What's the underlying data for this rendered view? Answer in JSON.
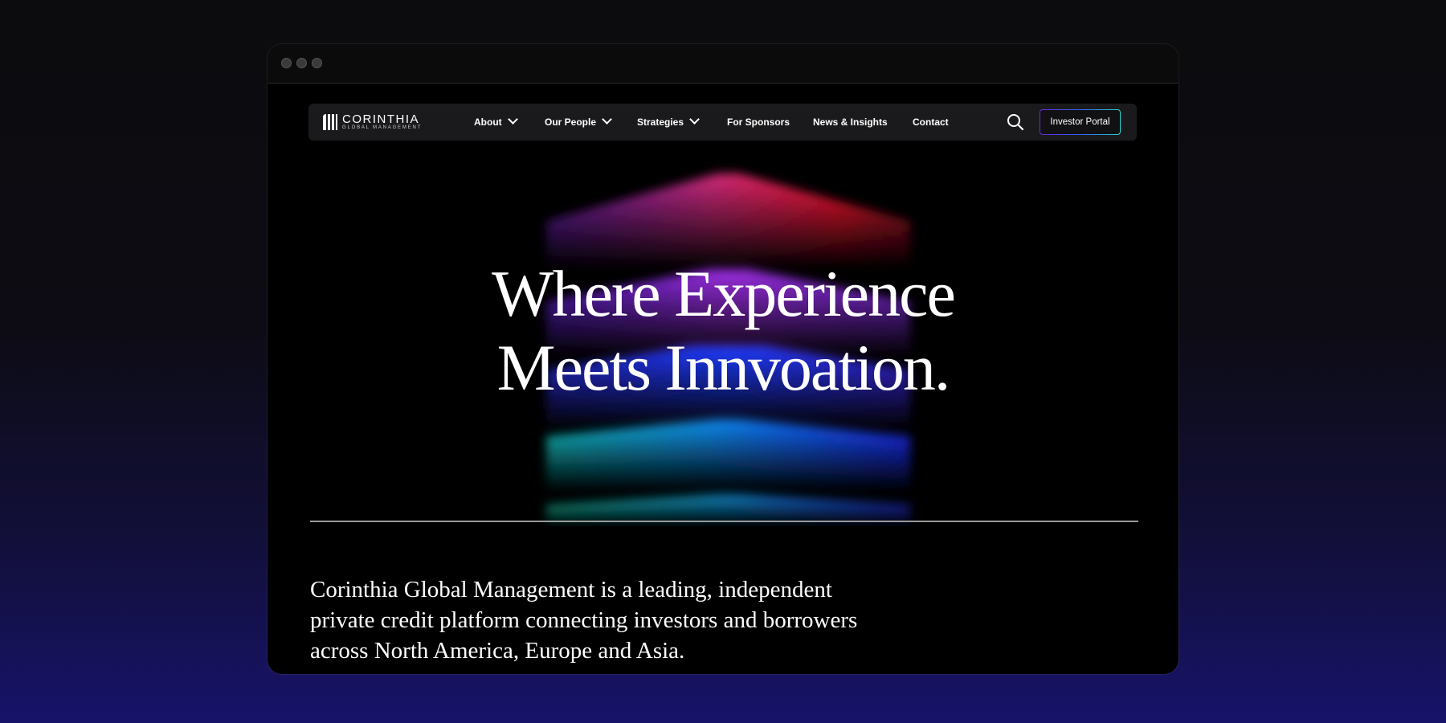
{
  "window": {
    "controls": [
      "close",
      "minimize",
      "maximize"
    ]
  },
  "nav": {
    "logo": {
      "word": "CORINTHIA",
      "sub": "GLOBAL MANAGEMENT"
    },
    "items": [
      {
        "label": "About",
        "dropdown": true
      },
      {
        "label": "Our People",
        "dropdown": true
      },
      {
        "label": "Strategies",
        "dropdown": true
      },
      {
        "label": "For Sponsors",
        "dropdown": false
      },
      {
        "label": "News & Insights",
        "dropdown": false
      },
      {
        "label": "Contact",
        "dropdown": false
      }
    ],
    "search_icon": "search-icon",
    "portal_label": "Investor Portal"
  },
  "hero": {
    "title_line1": "Where Experience",
    "title_line2": "Meets Innvoation."
  },
  "intro": "Corinthia Global Management is a leading, independent private credit platform connecting investors and borrowers across North America, Europe and Asia.",
  "colors": {
    "accent_red": "#ff1a3a",
    "accent_purple": "#9b2be0",
    "accent_blue": "#1f3bff",
    "accent_cyan": "#12d6d6"
  }
}
